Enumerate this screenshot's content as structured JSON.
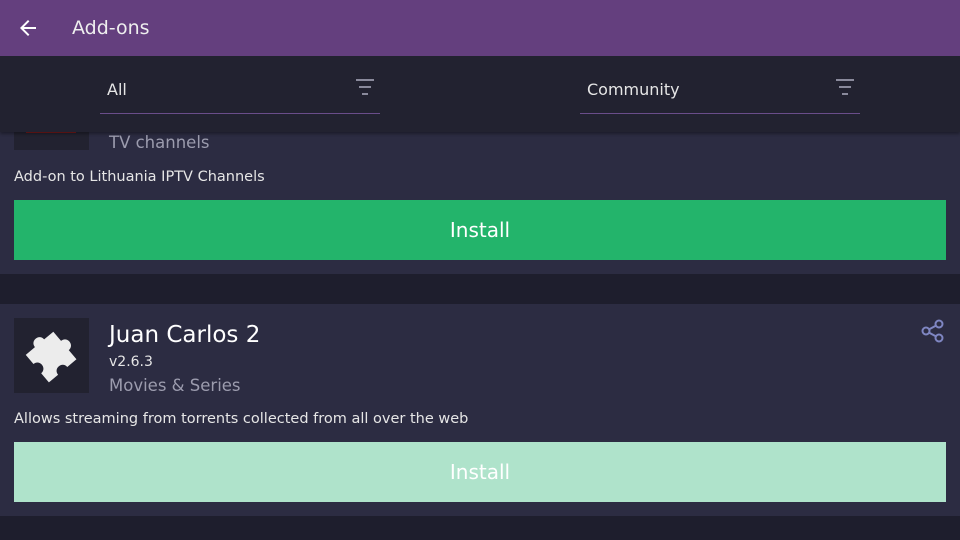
{
  "header": {
    "title": "Add-ons",
    "back_icon": "arrow-left-icon"
  },
  "filters": {
    "type": {
      "label": "All",
      "icon": "filter-lines-icon"
    },
    "source": {
      "label": "Community",
      "icon": "filter-lines-icon"
    }
  },
  "addons": [
    {
      "category": "TV channels",
      "description": "Add-on to Lithuania IPTV Channels",
      "install_label": "Install",
      "install_color": "#23b46b"
    },
    {
      "name": "Juan Carlos 2",
      "version": "v2.6.3",
      "category": "Movies & Series",
      "description": "Allows streaming from torrents collected from all over the web",
      "install_label": "Install",
      "install_color": "#afe3cb",
      "icon": "puzzle-piece-icon",
      "share_icon": "share-icon"
    }
  ],
  "colors": {
    "appbar": "#643f7e",
    "background": "#1e1e2d",
    "card": "#2c2c42",
    "muted_text": "#9c9cae",
    "share_icon": "#7f86c2"
  }
}
